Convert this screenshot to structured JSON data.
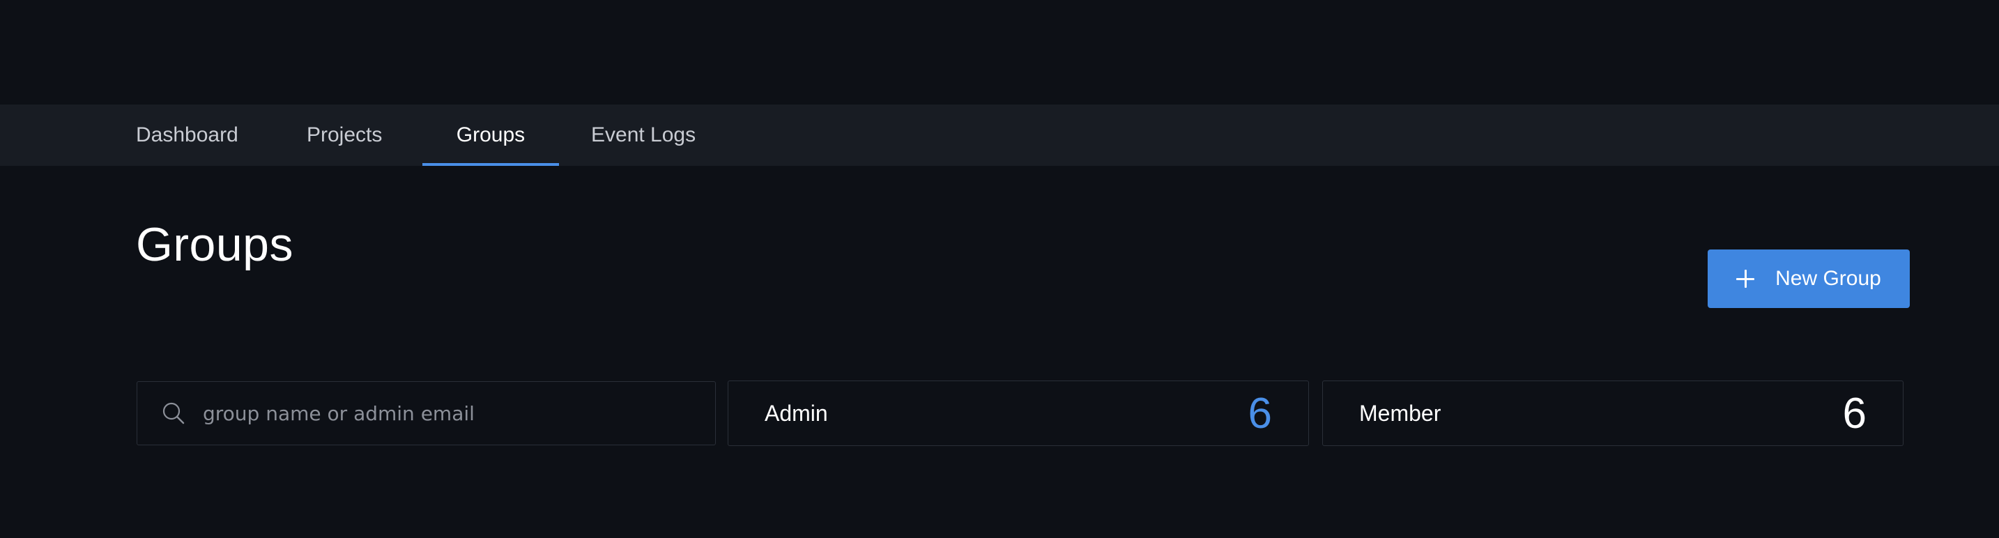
{
  "nav": {
    "tabs": [
      {
        "label": "Dashboard",
        "active": false
      },
      {
        "label": "Projects",
        "active": false
      },
      {
        "label": "Groups",
        "active": true
      },
      {
        "label": "Event Logs",
        "active": false
      }
    ]
  },
  "page": {
    "title": "Groups"
  },
  "toolbar": {
    "new_group_label": "New Group",
    "new_group_icon": "plus-icon"
  },
  "search": {
    "placeholder": "group name or admin email",
    "value": "",
    "icon": "search-icon"
  },
  "stats": {
    "admin": {
      "label": "Admin",
      "value": "6"
    },
    "member": {
      "label": "Member",
      "value": "6"
    }
  },
  "colors": {
    "background": "#0d1016",
    "nav_background": "#181c23",
    "accent": "#4a8fe8",
    "button": "#3f86e0",
    "border": "#2a2f38"
  }
}
